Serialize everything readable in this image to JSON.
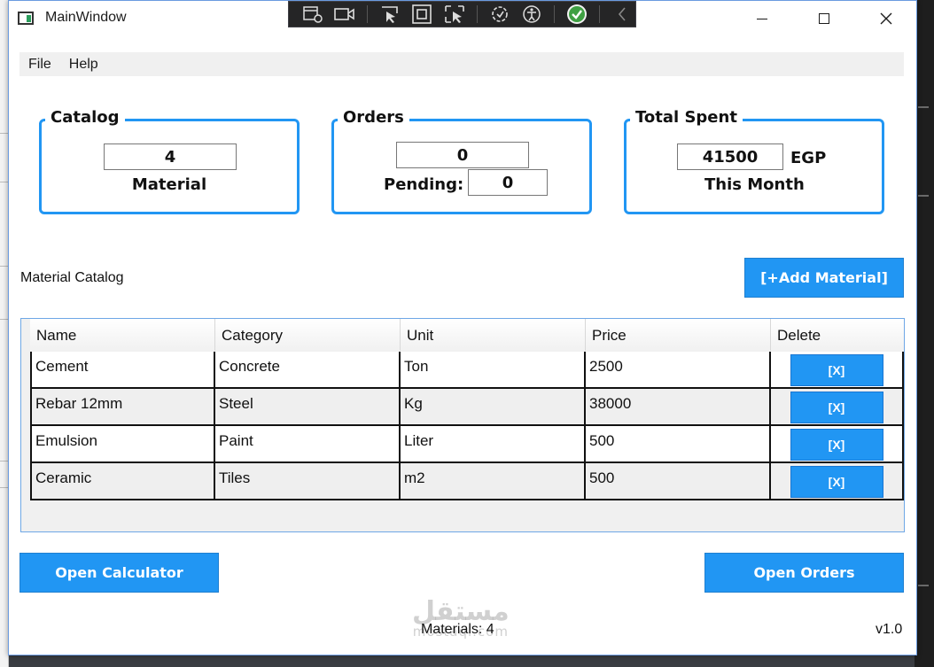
{
  "window": {
    "title": "MainWindow"
  },
  "debug_toolbar": {
    "icons": [
      "select-element-icon",
      "video-icon",
      "pointer-select-icon",
      "box-select-icon",
      "display-layout-icon",
      "hot-reload-icon",
      "accessibility-icon",
      "checkmark-icon",
      "chevron-left-icon"
    ]
  },
  "menu": {
    "items": [
      "File",
      "Help"
    ]
  },
  "cards": {
    "catalog": {
      "title": "Catalog",
      "value": "4",
      "label": "Material"
    },
    "orders": {
      "title": "Orders",
      "value": "0",
      "pending_label": "Pending:",
      "pending_value": "0"
    },
    "total_spent": {
      "title": "Total Spent",
      "value": "41500",
      "currency": "EGP",
      "period": "This Month"
    }
  },
  "catalog_section": {
    "title": "Material Catalog",
    "add_button": "[+Add Material]"
  },
  "table": {
    "columns": [
      "Name",
      "Category",
      "Unit",
      "Price",
      "Delete"
    ],
    "rows": [
      {
        "name": "Cement",
        "category": "Concrete",
        "unit": "Ton",
        "price": "2500",
        "delete": "[X]"
      },
      {
        "name": "Rebar 12mm",
        "category": "Steel",
        "unit": "Kg",
        "price": "38000",
        "delete": "[X]"
      },
      {
        "name": "Emulsion",
        "category": "Paint",
        "unit": "Liter",
        "price": "500",
        "delete": "[X]"
      },
      {
        "name": "Ceramic",
        "category": "Tiles",
        "unit": "m2",
        "price": "500",
        "delete": "[X]"
      }
    ]
  },
  "buttons": {
    "open_calculator": "Open Calculator",
    "open_orders": "Open Orders"
  },
  "status": {
    "materials": "Materials: 4",
    "version": "v1.0"
  },
  "watermark": {
    "arabic": "مستقل",
    "latin": "mostaql.com"
  },
  "colors": {
    "accent": "#2196f3",
    "grid_border": "#6ea7e6"
  }
}
